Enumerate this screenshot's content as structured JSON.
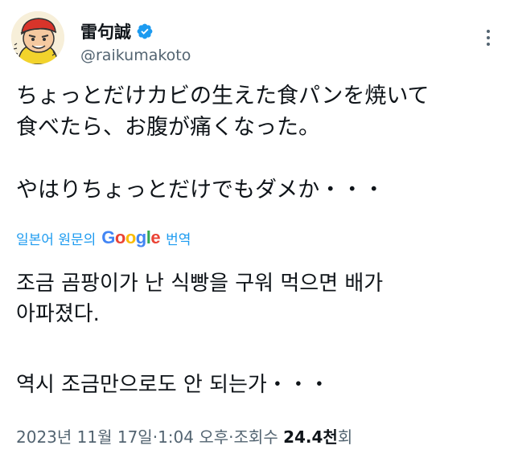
{
  "author": {
    "display_name": "雷句誠",
    "handle": "@raikumakoto",
    "verified_icon": "verified-badge-icon",
    "avatar_icon": "cartoon-avatar",
    "badge_color": "#1d9bf0"
  },
  "more_icon": "more-dots-icon",
  "tweet": {
    "lines": [
      "ちょっとだけカビの生えた食パンを焼いて",
      "食べたら、お腹が痛くなった。",
      "やはりちょっとだけでもダメか・・・"
    ]
  },
  "translation": {
    "prefix": "일본어 원문의",
    "google": [
      "G",
      "o",
      "o",
      "g",
      "l",
      "e"
    ],
    "google_colors": [
      "#4285F4",
      "#EA4335",
      "#FBBC05",
      "#4285F4",
      "#34A853",
      "#EA4335"
    ],
    "suffix": "번역",
    "lines": [
      "조금 곰팡이가 난 식빵을 구워 먹으면 배가",
      "아파졌다.",
      "역시 조금만으로도 안 되는가・・・"
    ]
  },
  "meta": {
    "date": "2023년 11월 17일",
    "separator": " · ",
    "time": "1:04 오후",
    "views_label": "조회수",
    "views_count": "24.4천",
    "views_suffix": "회"
  }
}
